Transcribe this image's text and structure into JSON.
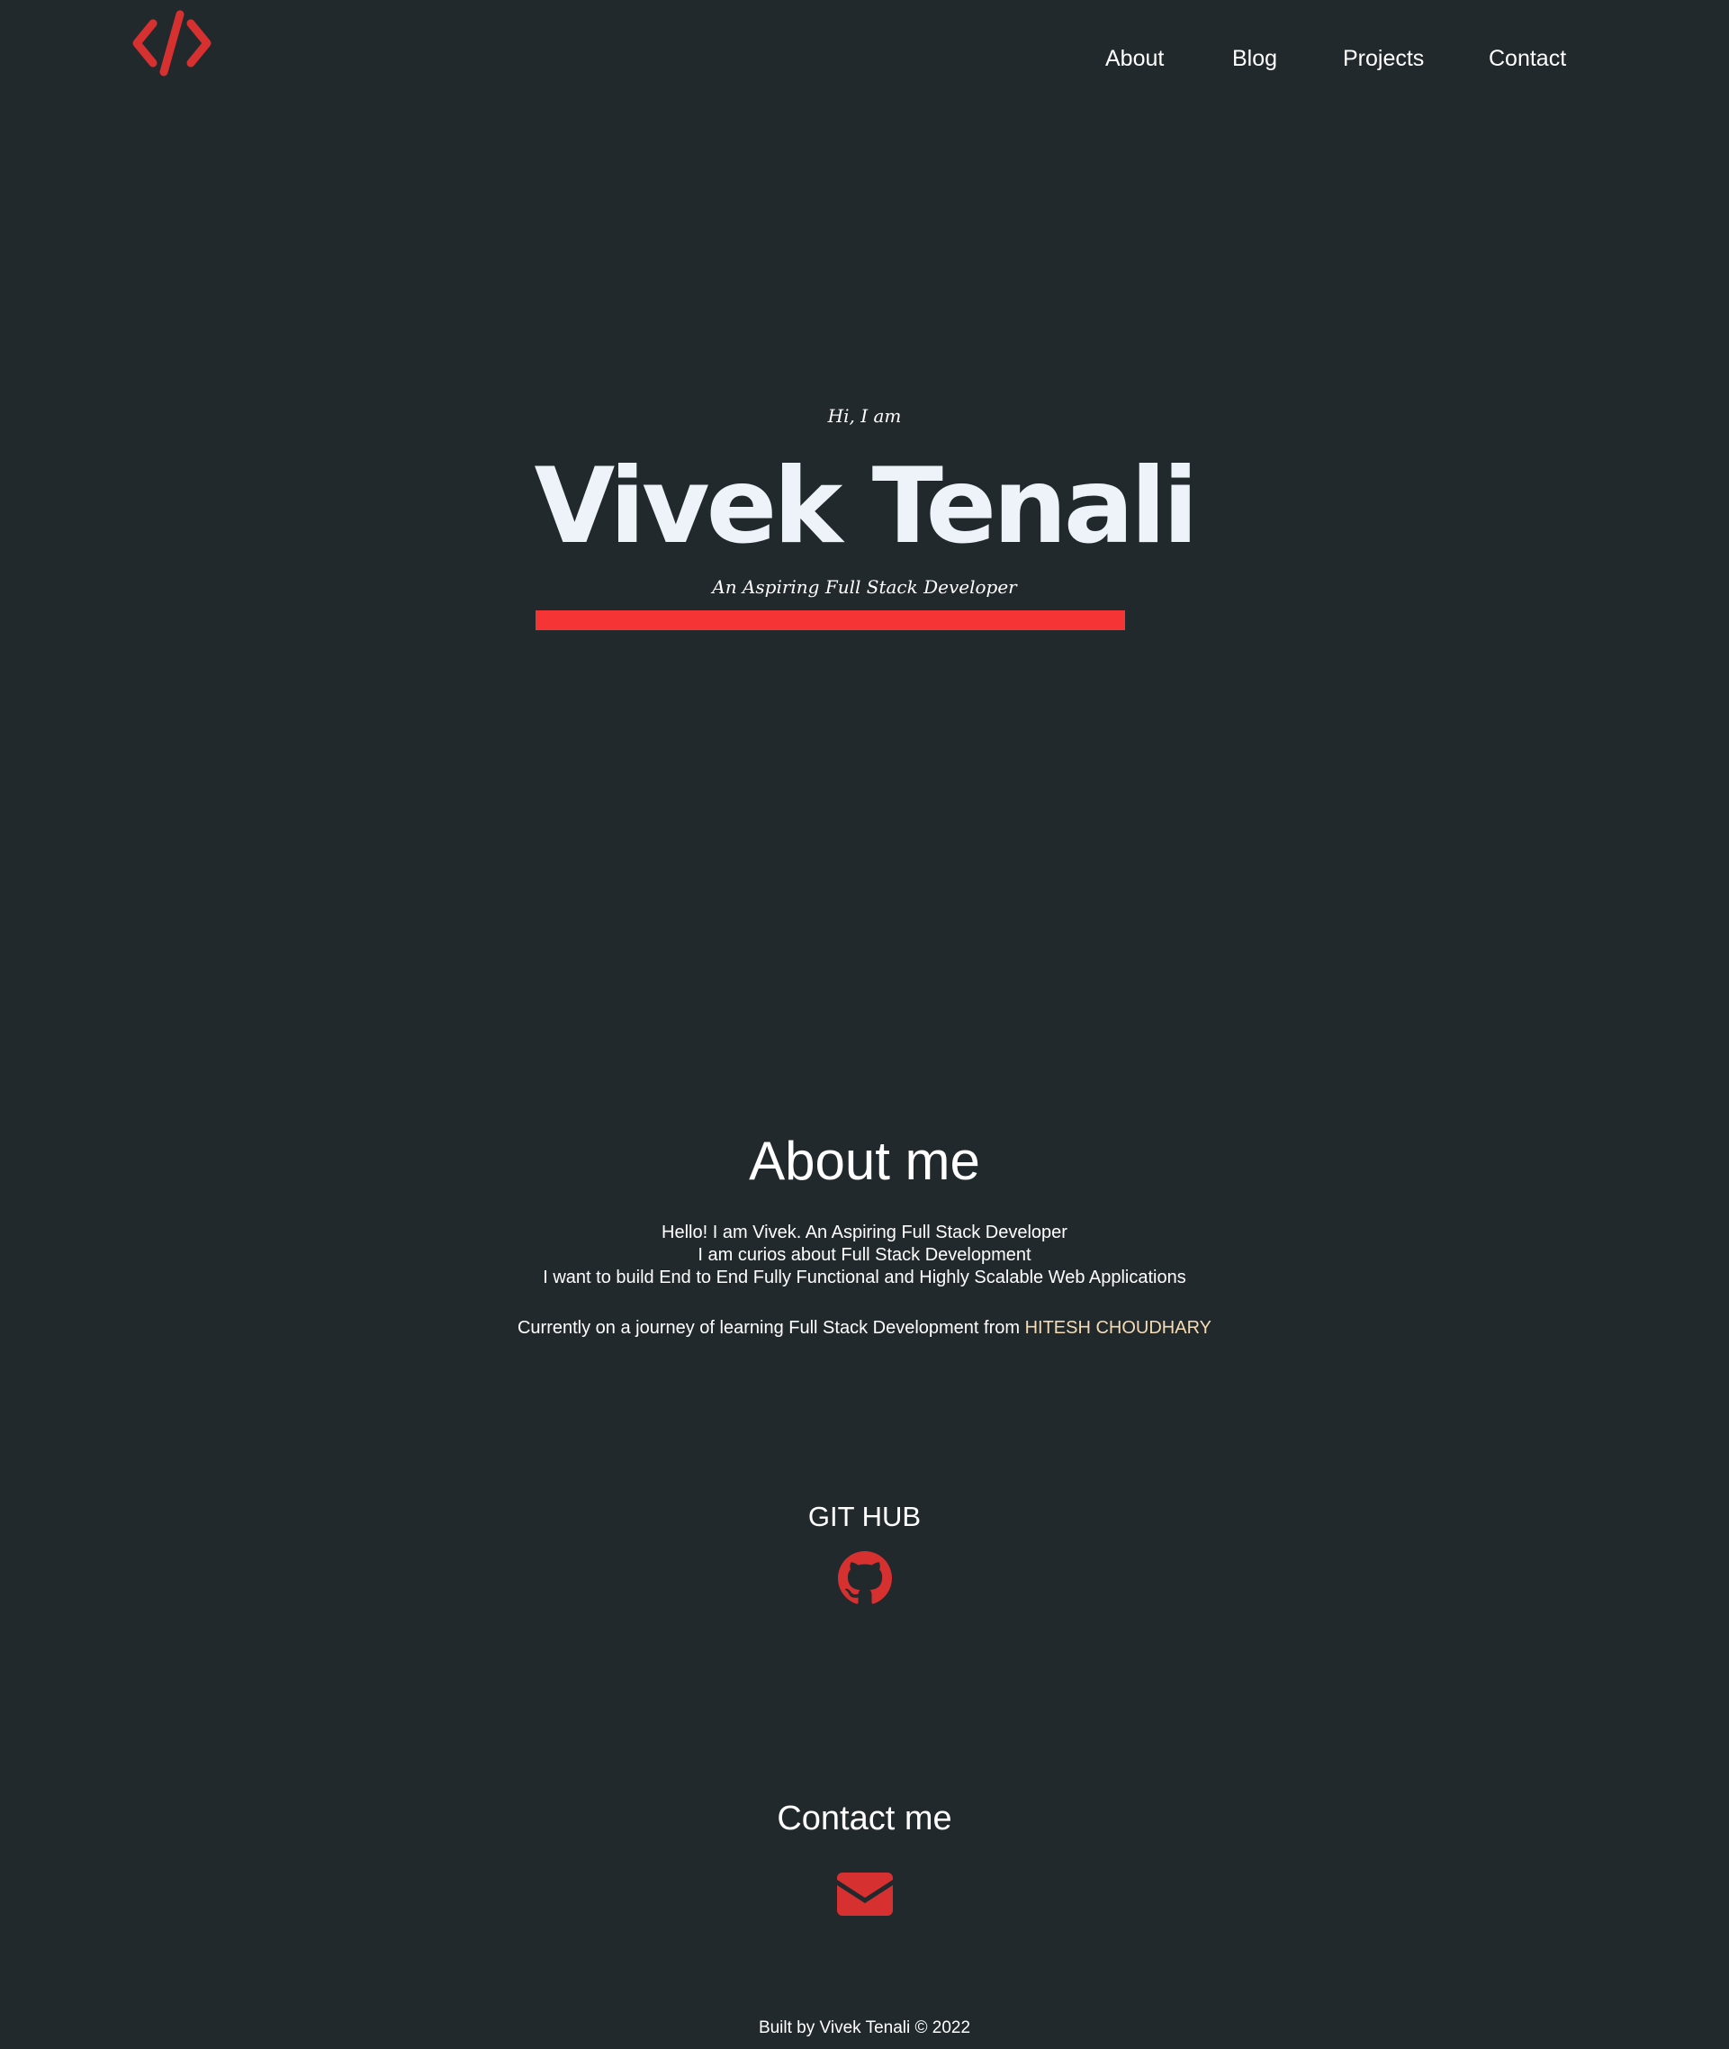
{
  "header": {
    "logo_icon": "code-brackets-icon",
    "nav": [
      {
        "label": "About"
      },
      {
        "label": "Blog"
      },
      {
        "label": "Projects"
      },
      {
        "label": "Contact"
      }
    ]
  },
  "hero": {
    "greeting": "Hi, I am",
    "name": "Vivek Tenali",
    "tagline": "An Aspiring Full Stack Developer"
  },
  "about": {
    "heading": "About me",
    "lines": [
      "Hello! I am Vivek. An Aspiring Full Stack Developer",
      "I am curios about Full Stack Development",
      "I want to build End to End Fully Functional and Highly Scalable Web Applications"
    ],
    "journey_text": "Currently on a journey of learning Full Stack Development from ",
    "mentor_link": "HITESH CHOUDHARY"
  },
  "github": {
    "heading": "GIT HUB",
    "icon": "github-icon"
  },
  "contact": {
    "heading": "Contact me",
    "icon": "envelope-icon"
  },
  "footer": {
    "text": "Built by Vivek Tenali © 2022"
  },
  "colors": {
    "background": "#22292d",
    "accent": "#f53535",
    "icon_red": "#d63031",
    "link": "#f5dcb5",
    "text": "#ffffff"
  }
}
